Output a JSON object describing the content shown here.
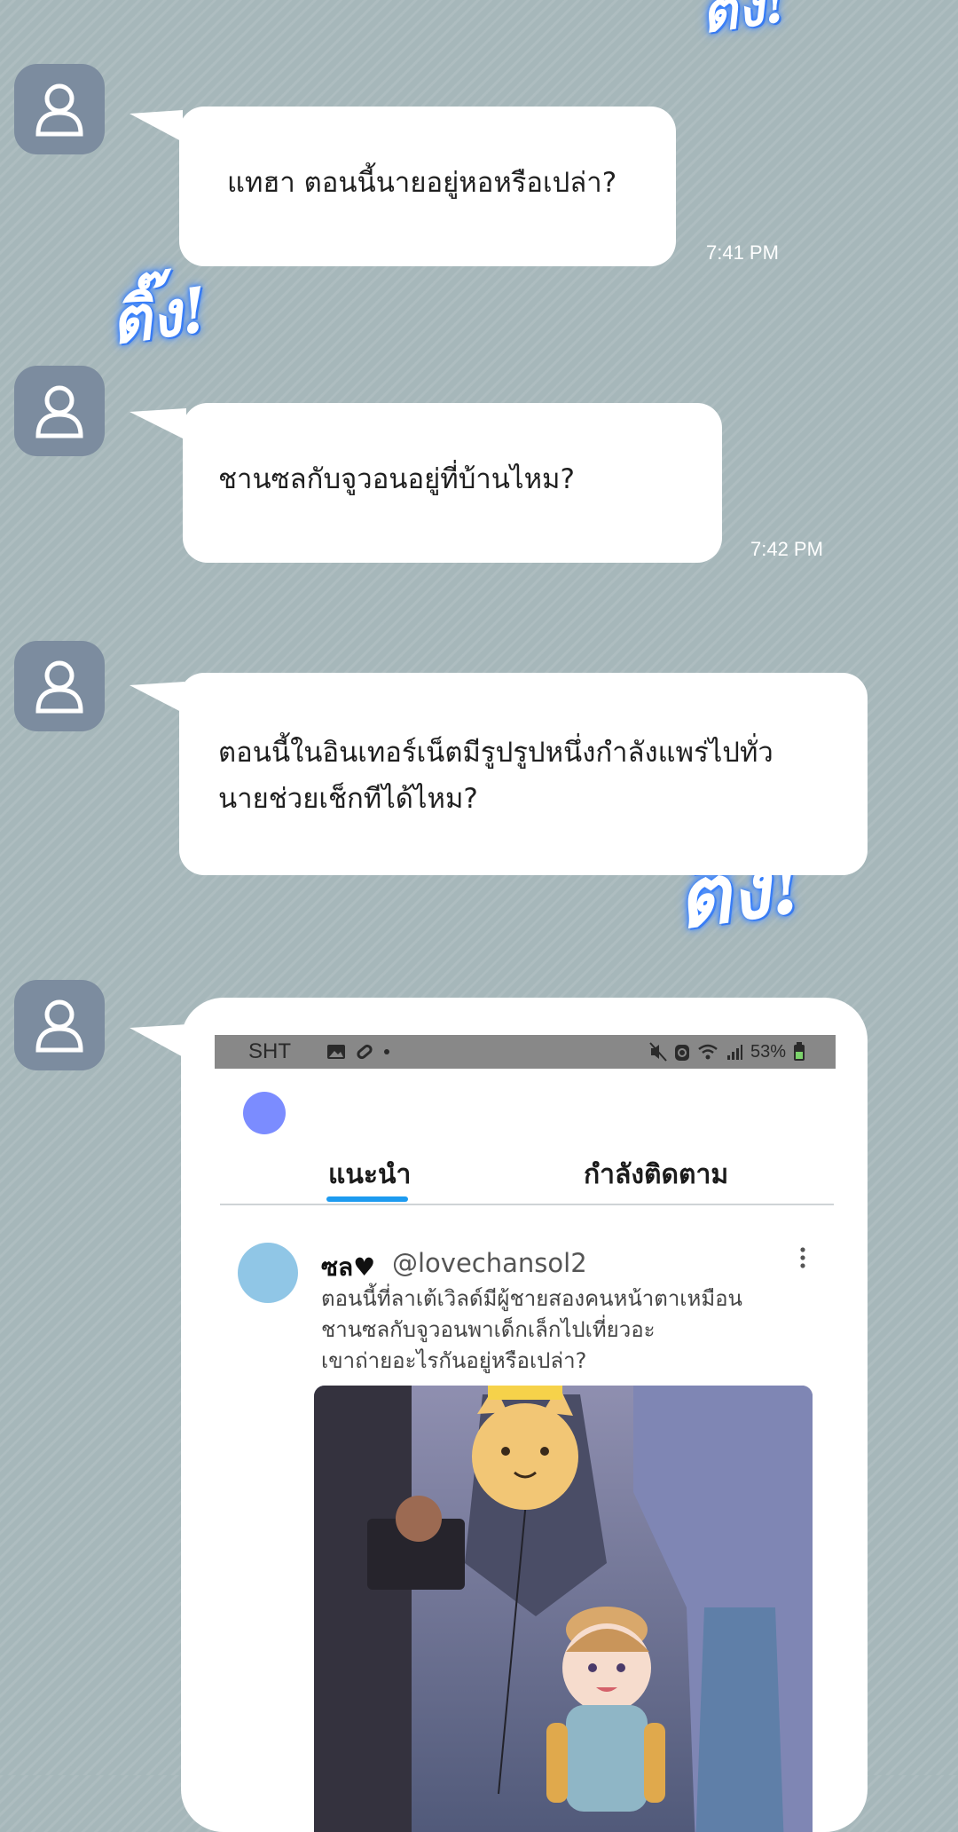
{
  "messages": [
    {
      "text_lines": [
        "แทฮา ตอนนี้นายอยู่หอหรือเปล่า?"
      ],
      "time": "7:41 PM"
    },
    {
      "text_lines": [
        "ชานซลกับจูวอนอยู่ที่บ้านไหม?"
      ],
      "time": "7:42 PM"
    },
    {
      "text_lines": [
        "ตอนนี้ในอินเทอร์เน็ตมีรูปรูปหนึ่งกำลังแพร่ไปทั่ว",
        "นายช่วยเช็กทีได้ไหม?"
      ],
      "time": ""
    }
  ],
  "sound_effects": [
    "ติ๊ง!",
    "ติ๊ง!",
    "ติ๊ง!"
  ],
  "screenshot": {
    "status_bar": {
      "carrier": "SHT",
      "battery": "53%"
    },
    "tabs": [
      {
        "label": "แนะนำ",
        "active": true
      },
      {
        "label": "กำลังติดตาม",
        "active": false
      }
    ],
    "post": {
      "name": "ซล♥",
      "handle": "@lovechansol2",
      "text_lines": [
        "ตอนนี้ที่ลาเต้เวิลด์มีผู้ชายสองคนหน้าตาเหมือน",
        "ชานซลกับจูวอนพาเด็กเล็กไปเที่ยวอะ",
        "เขาถ่ายอะไรกันอยู่หรือเปล่า?"
      ]
    }
  },
  "colors": {
    "accent": "#1d9bf0",
    "avatar_bg": "#7c8c9f",
    "glow": "#2f7bff"
  }
}
